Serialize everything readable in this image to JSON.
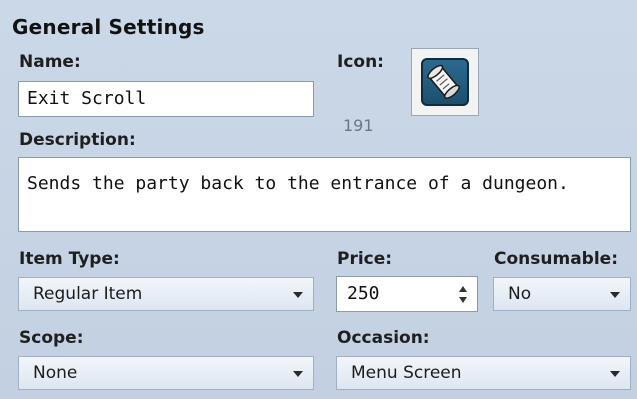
{
  "section": {
    "title": "General Settings"
  },
  "name": {
    "label": "Name:",
    "value": "Exit Scroll"
  },
  "icon": {
    "label": "Icon:",
    "index": "191",
    "icon_name": "scroll-icon"
  },
  "description": {
    "label": "Description:",
    "value": "Sends the party back to the entrance of a dungeon."
  },
  "item_type": {
    "label": "Item Type:",
    "selected": "Regular Item"
  },
  "price": {
    "label": "Price:",
    "value": "250"
  },
  "consumable": {
    "label": "Consumable:",
    "selected": "No"
  },
  "scope": {
    "label": "Scope:",
    "selected": "None"
  },
  "occasion": {
    "label": "Occasion:",
    "selected": "Menu Screen"
  },
  "colors": {
    "panel_bg": "#c6d3e3",
    "icon_bg": "#1f587a"
  }
}
